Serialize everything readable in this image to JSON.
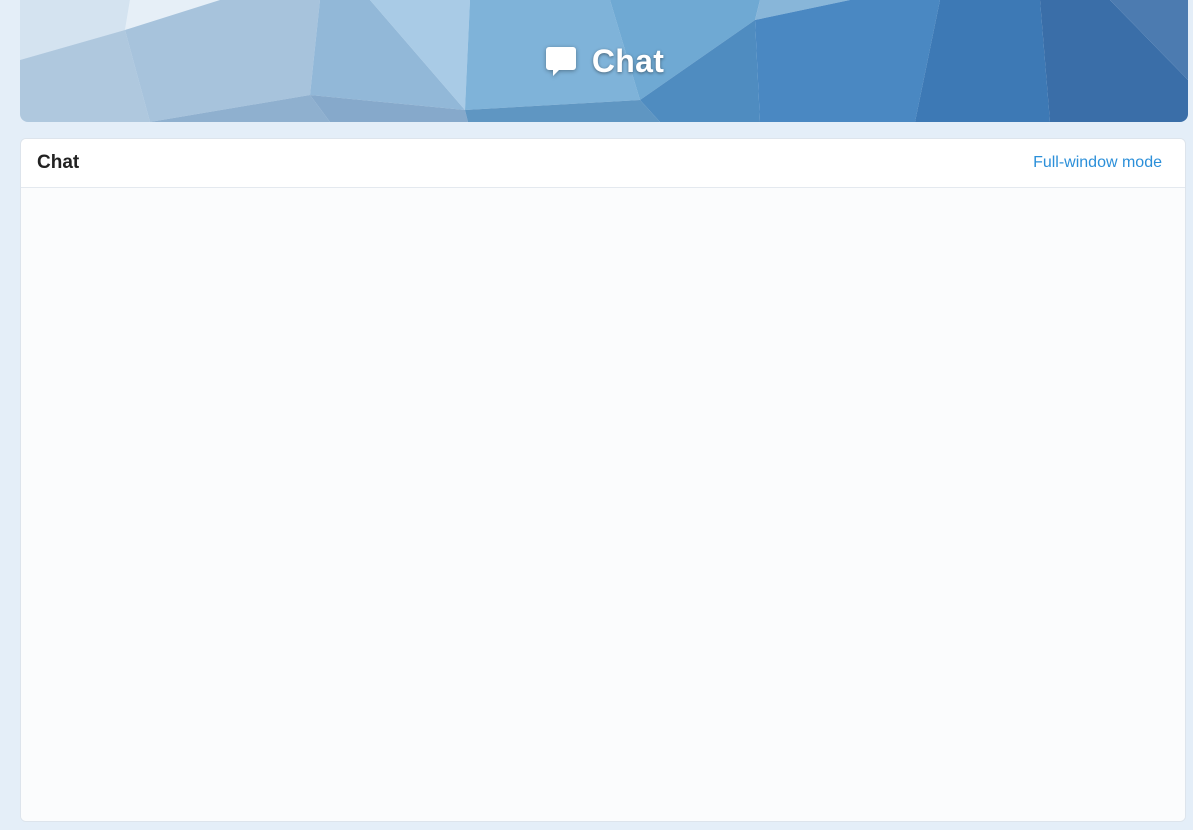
{
  "banner": {
    "title": "Chat",
    "icon": "speech-bubble-icon"
  },
  "panel": {
    "title": "Chat",
    "fullwindow_label": "Full-window mode"
  },
  "colors": {
    "page_background": "#e4eef8",
    "link": "#2b8fd9",
    "banner_light": "#c9dcec",
    "banner_dark": "#3a6ea8"
  }
}
